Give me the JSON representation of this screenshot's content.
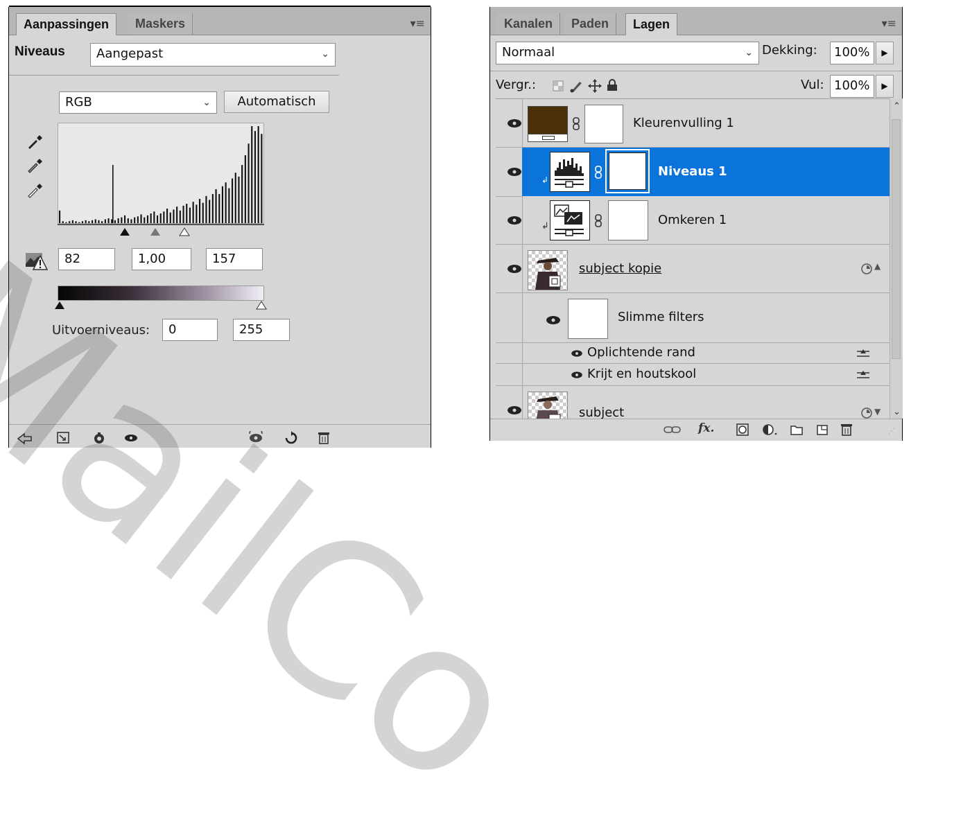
{
  "adjustments_panel": {
    "tabs": [
      {
        "label": "Aanpassingen",
        "active": true
      },
      {
        "label": "Maskers",
        "active": false
      }
    ],
    "adjustment_label": "Niveaus",
    "preset_value": "Aangepast",
    "channel_value": "RGB",
    "auto_button": "Automatisch",
    "input_black": "82",
    "input_gamma": "1,00",
    "input_white": "157",
    "output_label": "Uitvoerniveaus:",
    "output_black": "0",
    "output_white": "255",
    "histogram": [
      0.13,
      0.02,
      0.01,
      0.02,
      0.03,
      0.02,
      0.01,
      0.02,
      0.03,
      0.02,
      0.03,
      0.04,
      0.03,
      0.02,
      0.04,
      0.05,
      0.04,
      0.03,
      0.05,
      0.06,
      0.08,
      0.05,
      0.04,
      0.06,
      0.07,
      0.09,
      0.06,
      0.08,
      0.1,
      0.12,
      0.08,
      0.1,
      0.12,
      0.15,
      0.11,
      0.14,
      0.17,
      0.13,
      0.18,
      0.2,
      0.16,
      0.22,
      0.19,
      0.25,
      0.21,
      0.28,
      0.24,
      0.3,
      0.35,
      0.3,
      0.38,
      0.42,
      0.36,
      0.46,
      0.52,
      0.48,
      0.6,
      0.7,
      0.82,
      1.0,
      0.95,
      1.0,
      0.92
    ],
    "histogram_spike": 0.6
  },
  "layers_panel": {
    "tabs": [
      {
        "label": "Kanalen",
        "active": false
      },
      {
        "label": "Paden",
        "active": false
      },
      {
        "label": "Lagen",
        "active": true
      }
    ],
    "blend_mode": "Normaal",
    "opacity_label": "Dekking:",
    "opacity_value": "100%",
    "lock_label": "Vergr.:",
    "fill_label": "Vul:",
    "fill_value": "100%",
    "fill_color": "#4a2f08",
    "selection_color": "#0a74da",
    "layers": [
      {
        "name": "Kleurenvulling 1",
        "selected": false
      },
      {
        "name": "Niveaus 1",
        "selected": true
      },
      {
        "name": "Omkeren 1",
        "selected": false
      },
      {
        "name": "subject kopie",
        "selected": false
      },
      {
        "name": "Slimme filters",
        "selected": false
      },
      {
        "name": "Oplichtende rand",
        "selected": false
      },
      {
        "name": "Krijt en houtskool",
        "selected": false
      },
      {
        "name": "subject",
        "selected": false
      }
    ],
    "footer_icons": [
      "link-icon",
      "fx-icon",
      "mask-icon",
      "adjustment-icon",
      "folder-icon",
      "new-layer-icon",
      "trash-icon"
    ]
  },
  "watermark": "MailCo"
}
